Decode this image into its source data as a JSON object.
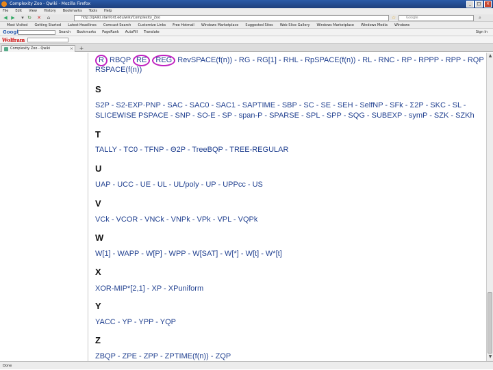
{
  "window": {
    "title": "Complexity Zoo - Qwiki - Mozilla Firefox"
  },
  "menu": [
    "File",
    "Edit",
    "View",
    "History",
    "Bookmarks",
    "Tools",
    "Help"
  ],
  "nav": {
    "url": "http://qwiki.stanford.edu/wiki/Complexity_Zoo",
    "search_placeholder": "Google"
  },
  "bookmarks": [
    "Most Visited",
    "Getting Started",
    "Latest Headlines",
    "Comcast Search",
    "Customize Links",
    "Free Hotmail",
    "Windows Marketplace",
    "Suggested Sites",
    "Web Slice Gallery",
    "Windows Marketplace",
    "Windows Media",
    "Windows"
  ],
  "google_bar": {
    "logo": "Google",
    "items": [
      "Search",
      "Bookmarks",
      "PageRank",
      "AutoFill",
      "Translate"
    ],
    "right": "Sign In"
  },
  "wolfram_bar": {
    "logo": "Wolfram"
  },
  "tab": {
    "label": "Complexity Zoo - Qwiki"
  },
  "status": "Done",
  "content": {
    "top_line": {
      "circled": [
        "R",
        "RE",
        "REG"
      ],
      "rest": "RevSPACE(f(n)) - RG - RG[1] - RHL - RpSPACE(f(n)) - RL - RNC - RP - RPPP - RPP - RQP -",
      "line2": "RSPACE(f(n))"
    },
    "sections": [
      {
        "letter": "S",
        "lines": [
          "S2P - S2-EXP·PNP - SAC - SAC0 - SAC1 - SAPTIME - SBP - SC - SE - SEH - SelfNP - SFk - Σ2P - SKC - SL -",
          "SLICEWISE PSPACE - SNP - SO-E - SP - span-P - SPARSE - SPL - SPP - SQG - SUBEXP - symP - SZK - SZKh"
        ]
      },
      {
        "letter": "T",
        "lines": [
          "TALLY - TC0 - TFNP - Θ2P - TreeBQP - TREE-REGULAR"
        ]
      },
      {
        "letter": "U",
        "lines": [
          "UAP - UCC - UE - UL - UL/poly - UP - UPPcc - US"
        ]
      },
      {
        "letter": "V",
        "lines": [
          "VCk - VCOR - VNCk - VNPk - VPk - VPL - VQPk"
        ]
      },
      {
        "letter": "W",
        "lines": [
          "W[1] - WAPP - W[P] - WPP - W[SAT] - W[*] - W[t] - W*[t]"
        ]
      },
      {
        "letter": "X",
        "lines": [
          "XOR-MIP*[2,1] - XP - XPuniform"
        ]
      },
      {
        "letter": "Y",
        "lines": [
          "YACC - YP - YPP - YQP"
        ]
      },
      {
        "letter": "Z",
        "lines": [
          "ZBQP - ZPE - ZPP - ZPTIME(f(n)) - ZQP"
        ]
      }
    ]
  }
}
